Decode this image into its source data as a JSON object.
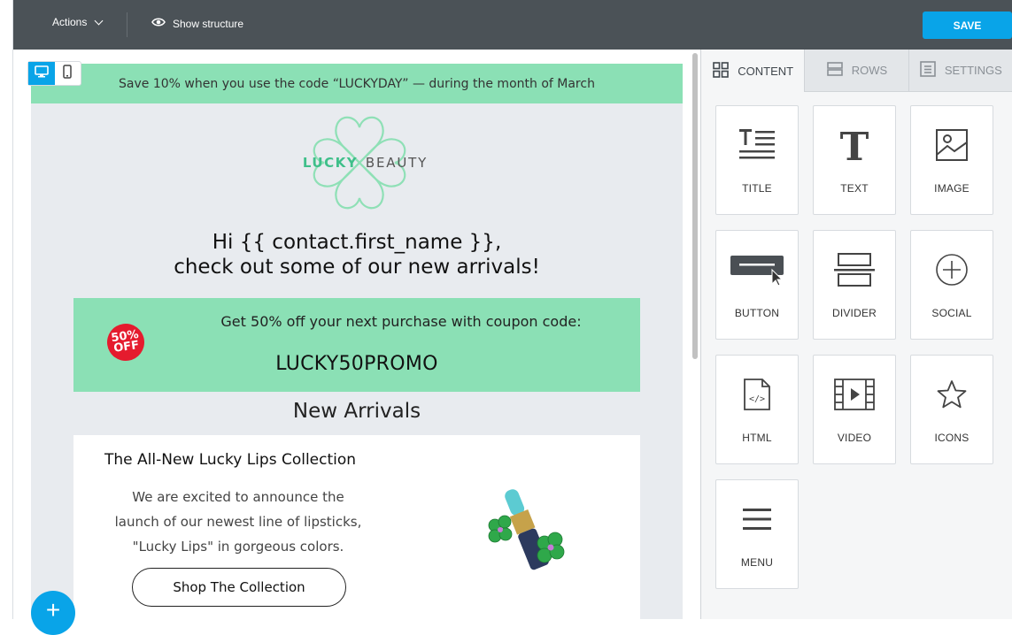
{
  "toolbar": {
    "actions_label": "Actions",
    "show_structure_label": "Show structure",
    "save_label": "SAVE"
  },
  "email": {
    "promo_bar": "Save 10% when you use the code “LUCKYDAY” — during the month of March",
    "logo_lucky": "LUCKY",
    "logo_beauty": "BEAUTY",
    "greeting_line1": "Hi {{ contact.first_name }},",
    "greeting_line2": "check out some of our new arrivals!",
    "coupon_badge_top": "50%",
    "coupon_badge_bottom": "OFF",
    "coupon_text": "Get 50% off your next purchase with coupon code:",
    "coupon_code": "LUCKY50PROMO",
    "section_heading": "New Arrivals",
    "product_title": "The All-New Lucky Lips Collection",
    "product_desc_line1": "We are excited to announce the",
    "product_desc_line2": "launch of our newest line of  lipsticks,",
    "product_desc_line3": "\"Lucky Lips\" in gorgeous colors.",
    "shop_button": "Shop The Collection"
  },
  "panel": {
    "tabs": [
      {
        "label": "CONTENT",
        "icon": "grid-icon",
        "active": true
      },
      {
        "label": "ROWS",
        "icon": "rows-icon",
        "active": false
      },
      {
        "label": "SETTINGS",
        "icon": "settings-icon",
        "active": false
      }
    ],
    "tiles": [
      {
        "label": "TITLE",
        "icon": "title-icon"
      },
      {
        "label": "TEXT",
        "icon": "text-icon"
      },
      {
        "label": "IMAGE",
        "icon": "image-icon"
      },
      {
        "label": "BUTTON",
        "icon": "button-icon"
      },
      {
        "label": "DIVIDER",
        "icon": "divider-icon"
      },
      {
        "label": "SOCIAL",
        "icon": "social-icon"
      },
      {
        "label": "HTML",
        "icon": "html-icon"
      },
      {
        "label": "VIDEO",
        "icon": "video-icon"
      },
      {
        "label": "ICONS",
        "icon": "star-icon"
      },
      {
        "label": "MENU",
        "icon": "menu-icon"
      }
    ]
  },
  "colors": {
    "accent": "#09a4e8",
    "topbar": "#4b5257",
    "mint": "#8be0b5",
    "logo_green": "#3fbf8a",
    "badge_red": "#e51b2e"
  }
}
